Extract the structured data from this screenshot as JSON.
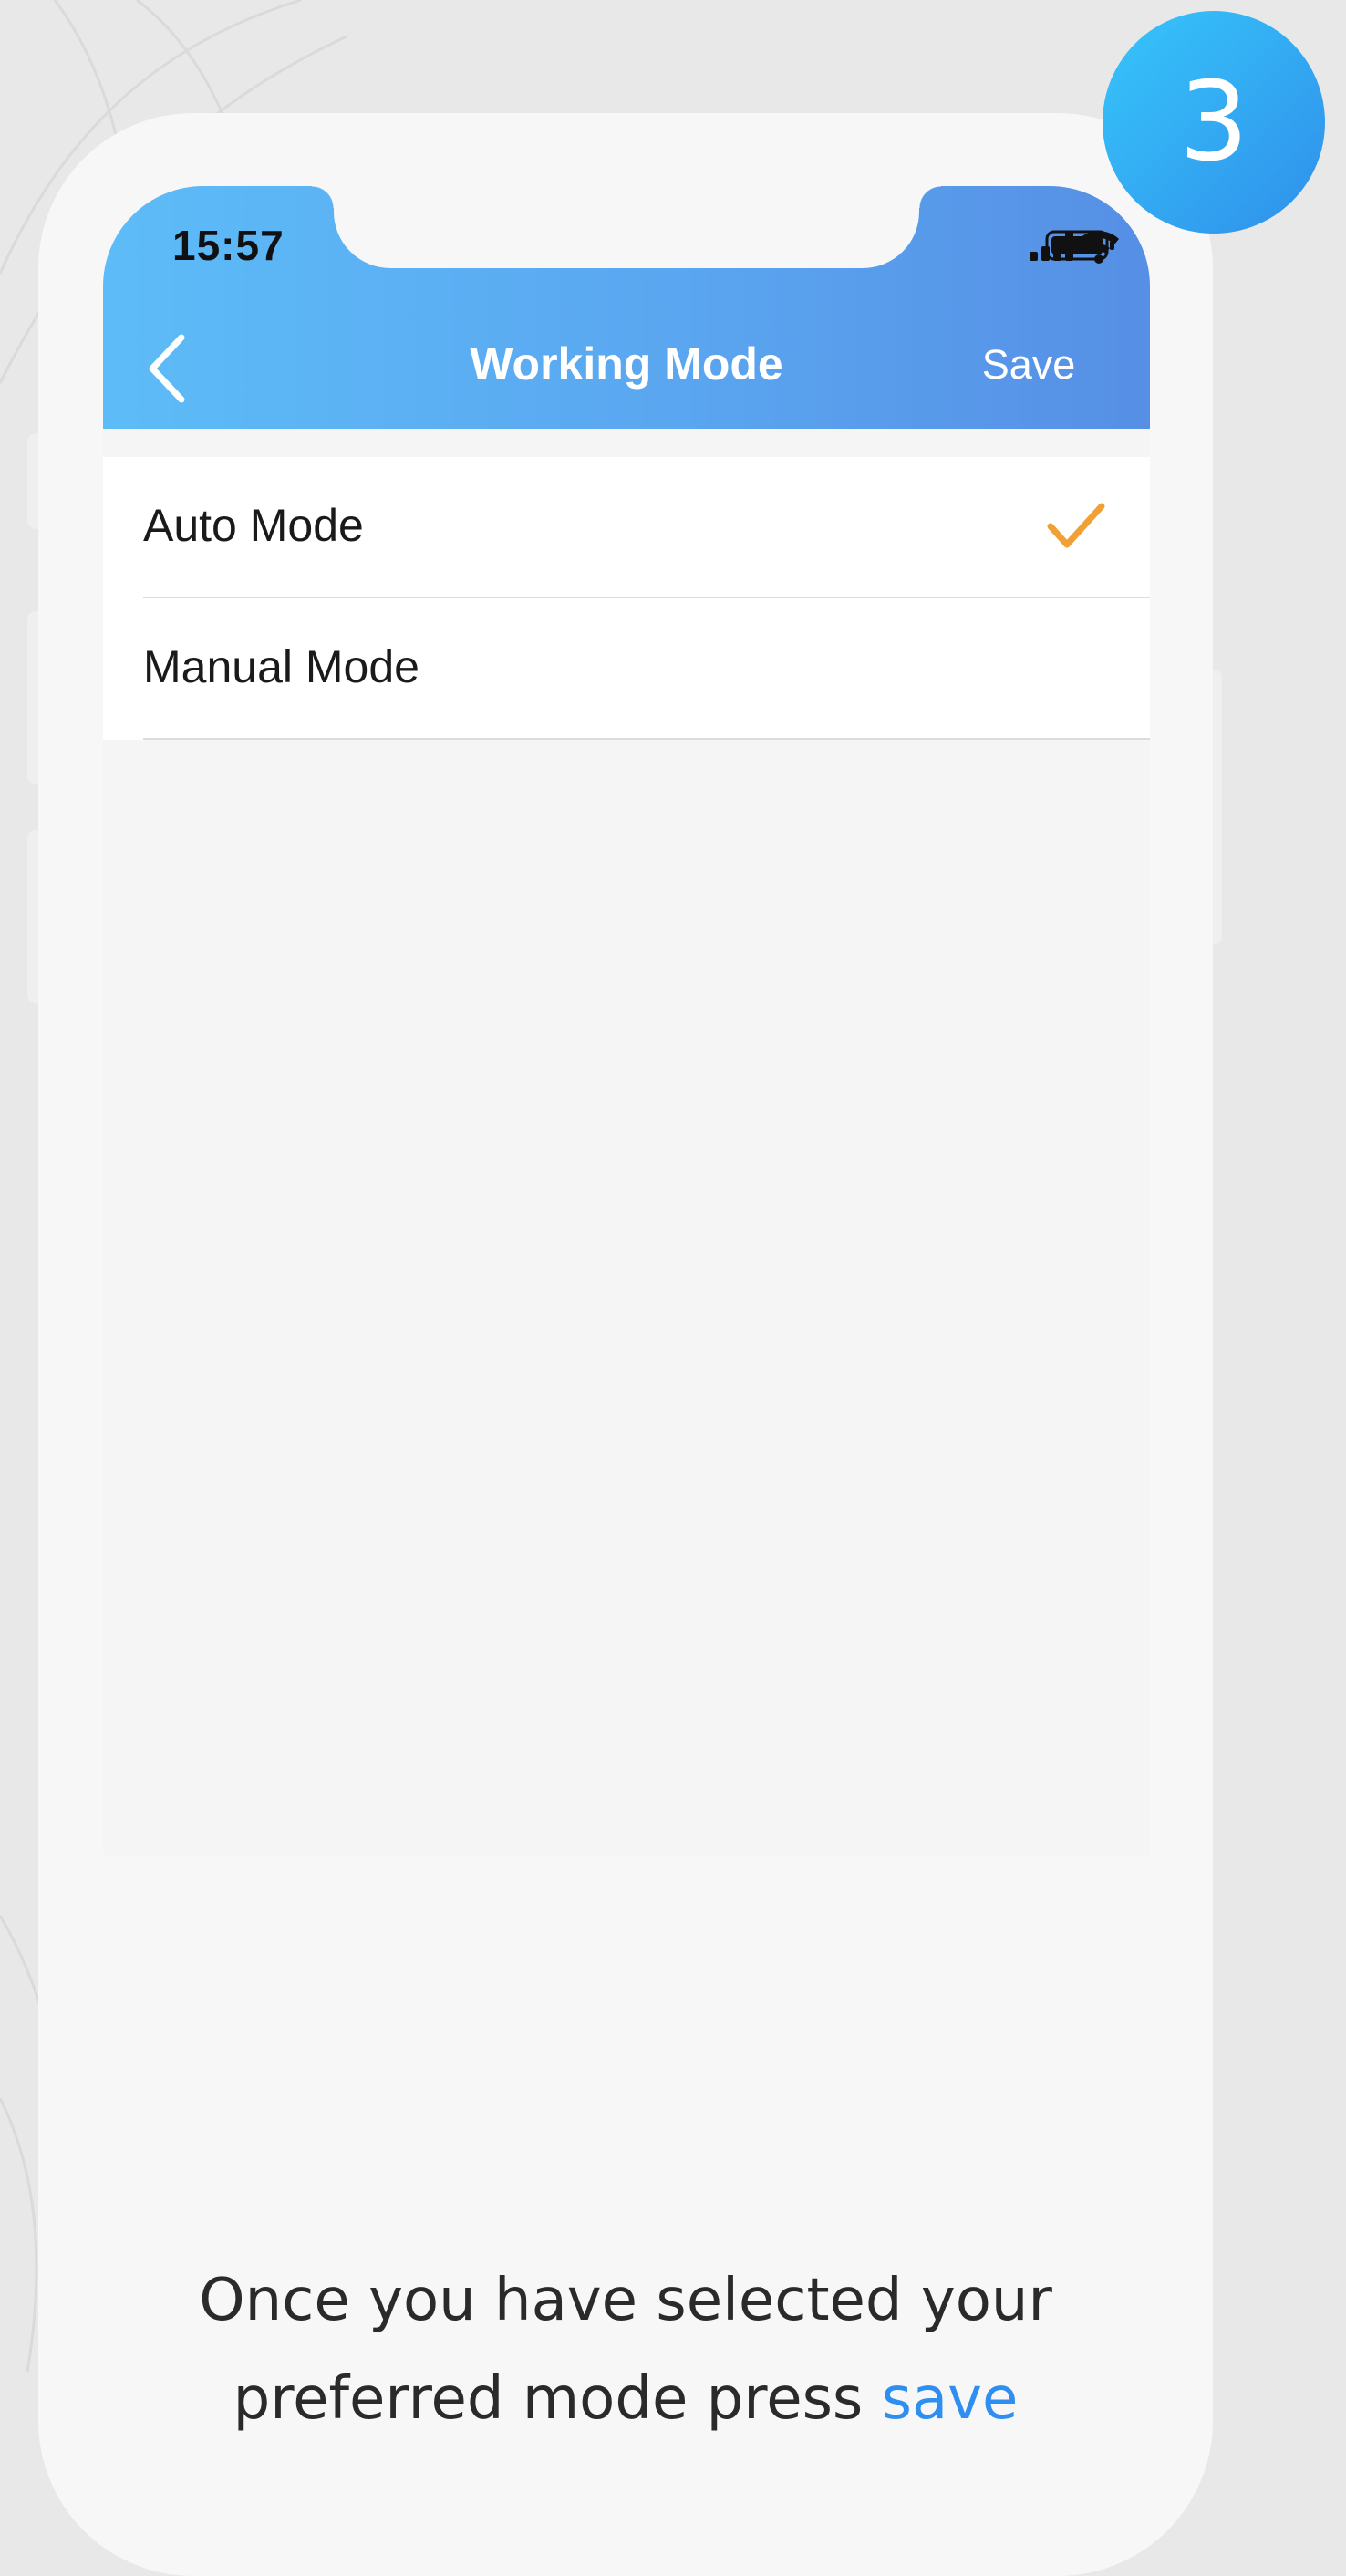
{
  "step_badge": "3",
  "status_bar": {
    "time": "15:57"
  },
  "nav": {
    "back_icon": "chevron-left-icon",
    "title": "Working Mode",
    "save_label": "Save"
  },
  "modes": [
    {
      "label": "Auto Mode",
      "selected": true
    },
    {
      "label": "Manual Mode",
      "selected": false
    }
  ],
  "caption": {
    "line1": "Once you have selected your",
    "line2_prefix": "preferred mode press ",
    "line2_accent": "save"
  },
  "colors": {
    "header_start": "#5dbcf7",
    "header_end": "#568fe5",
    "check": "#f0a035",
    "accent": "#2f8ff0",
    "badge": "#2fa9f5"
  }
}
